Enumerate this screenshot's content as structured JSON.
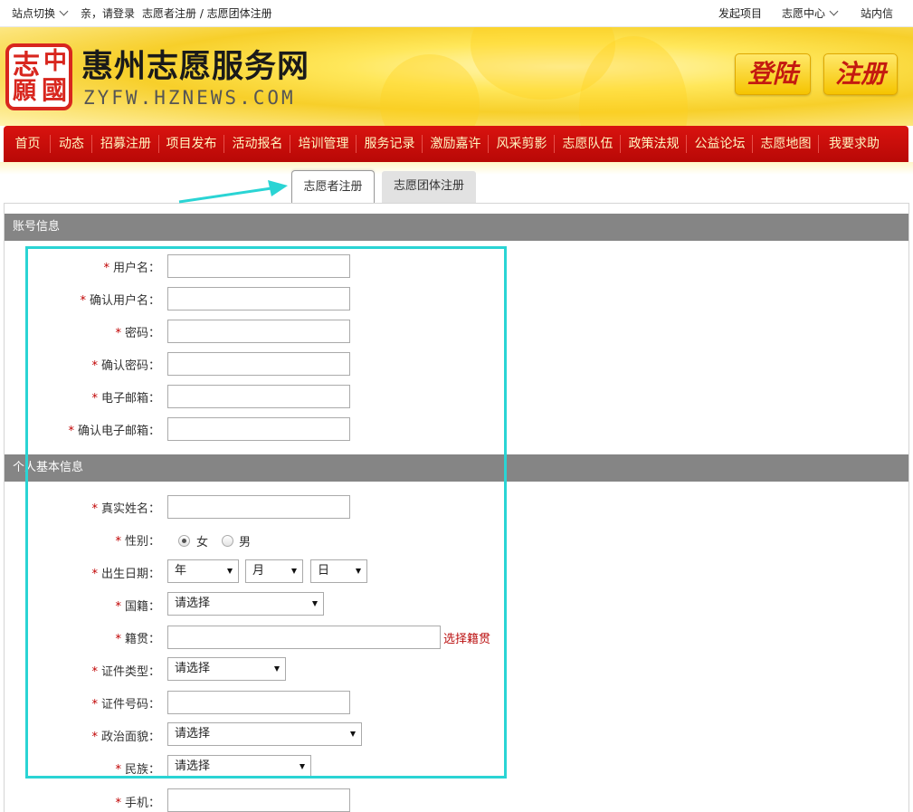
{
  "topbar": {
    "site_switch": "站点切换",
    "greeting": "亲，请登录",
    "breadcrumb": "志愿者注册 / 志愿团体注册",
    "launch_project": "发起项目",
    "volunteer_center": "志愿中心",
    "messages": "站内信"
  },
  "header": {
    "seal_chars": [
      "志",
      "中",
      "願",
      "國"
    ],
    "title": "惠州志愿服务网",
    "subtitle": "ZYFW.HZNEWS.COM",
    "login_button": "登陆",
    "register_button": "注册"
  },
  "nav": {
    "items": [
      "首页",
      "动态",
      "招募注册",
      "项目发布",
      "活动报名",
      "培训管理",
      "服务记录",
      "激励嘉许",
      "风采剪影",
      "志愿队伍",
      "政策法规",
      "公益论坛",
      "志愿地图",
      "我要求助"
    ]
  },
  "tabs": {
    "volunteer": "志愿者注册",
    "group": "志愿团体注册"
  },
  "sections": {
    "account": "账号信息",
    "personal": "个人基本信息"
  },
  "form": {
    "required_mark": "*",
    "username": "用户名：",
    "confirm_username": "确认用户名：",
    "password": "密码：",
    "confirm_password": "确认密码：",
    "email": "电子邮箱：",
    "confirm_email": "确认电子邮箱：",
    "real_name": "真实姓名：",
    "gender": "性别：",
    "gender_female": "女",
    "gender_male": "男",
    "birthdate": "出生日期：",
    "year": "年",
    "month": "月",
    "day": "日",
    "nationality": "国籍：",
    "native_place": "籍贯：",
    "choose_native_place": "选择籍贯",
    "id_type": "证件类型：",
    "id_number": "证件号码：",
    "political_status": "政治面貌：",
    "ethnicity": "民族：",
    "phone": "手机：",
    "please_select": "请选择"
  },
  "colors": {
    "nav_red": "#c90f0b",
    "section_gray": "#858585",
    "highlight": "#2ad4d4",
    "required": "#c00000"
  }
}
